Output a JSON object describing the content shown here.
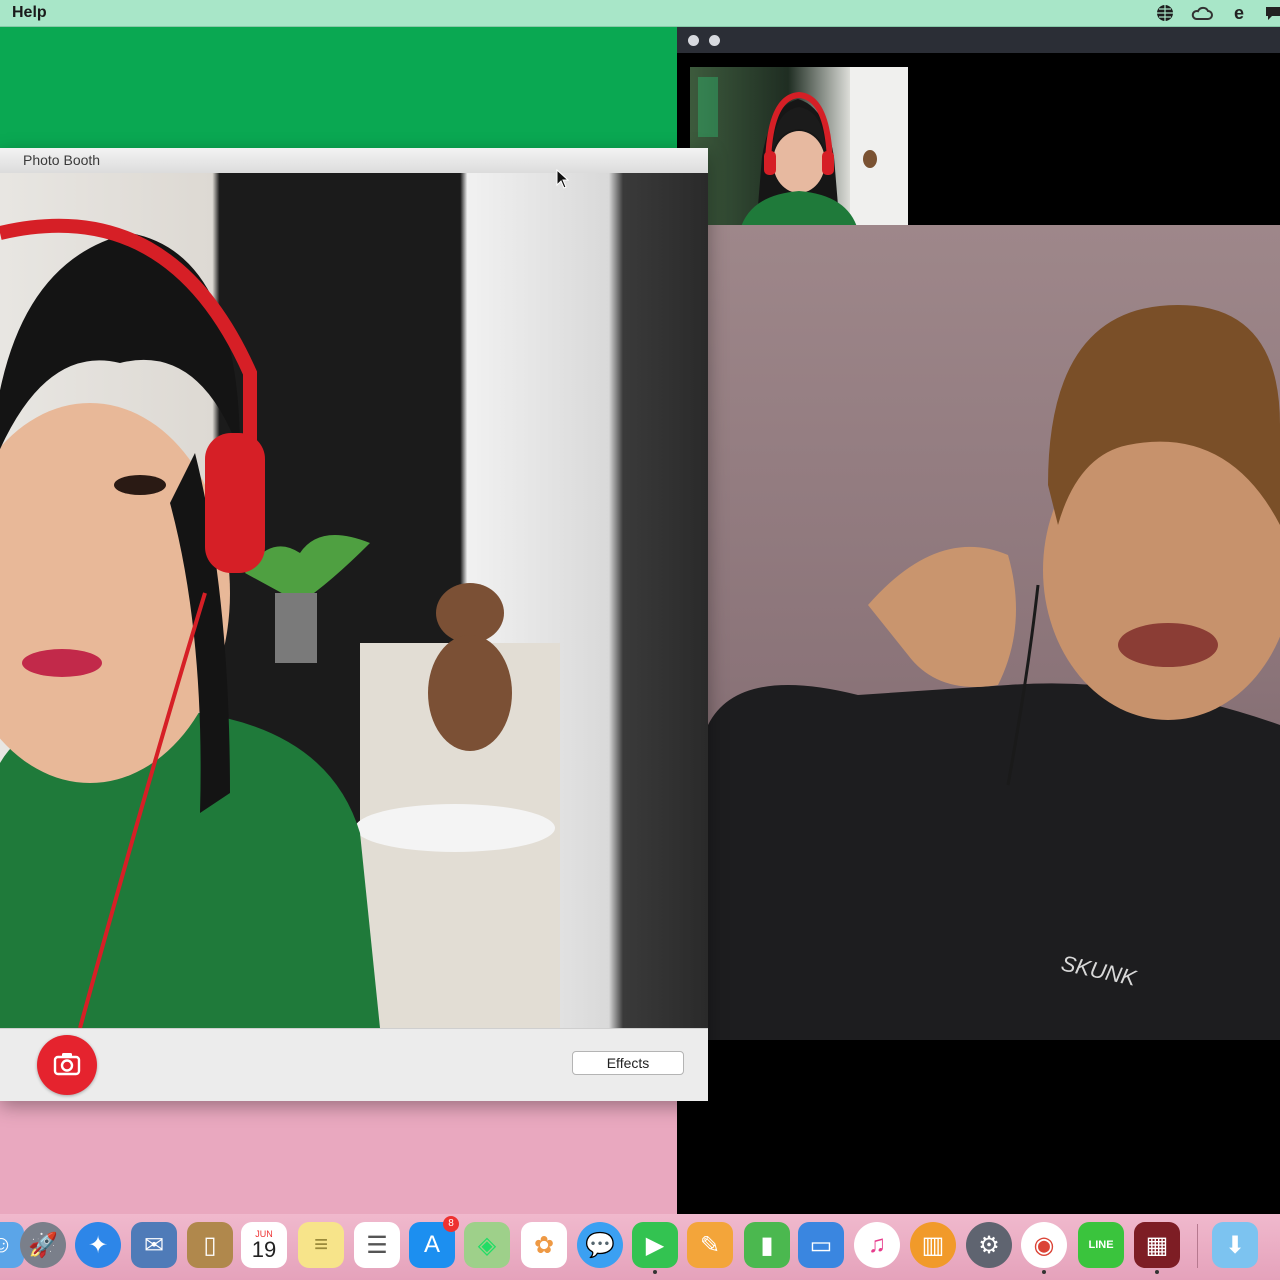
{
  "menubar": {
    "menu_help": "Help",
    "status_icons": [
      "globe-icon",
      "creative-cloud-icon",
      "evernote-icon",
      "chat-bubble-icon"
    ]
  },
  "photobooth": {
    "title": "Photo Booth",
    "effects_label": "Effects",
    "shutter_icon": "camera-icon"
  },
  "remote_shirt_text": "SKUNK",
  "dock": {
    "calendar": {
      "month": "JUN",
      "day": "19"
    },
    "app_store_badge": "8",
    "line_label": "LINE",
    "apps": [
      "finder",
      "launchpad",
      "safari",
      "preview",
      "contacts",
      "calendar",
      "notes",
      "reminders",
      "app-store",
      "maps",
      "photos",
      "messages",
      "facetime",
      "pages",
      "numbers",
      "keynote",
      "itunes",
      "ibooks",
      "system-preferences",
      "chrome",
      "line",
      "photo-booth",
      "downloads"
    ]
  },
  "colors": {
    "menubar": "#a8e6c8",
    "desktop_green": "#0aa852",
    "desktop_pink": "#e9a8bf",
    "shutter_red": "#e5232e"
  }
}
